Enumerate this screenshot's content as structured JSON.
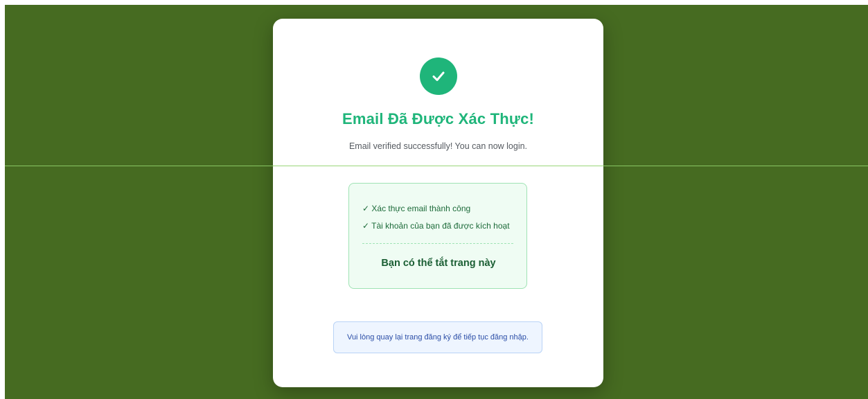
{
  "page": {
    "background_color": "#466b21",
    "accent_color": "#1fb57a"
  },
  "card": {
    "icon": "checkmark-icon",
    "title": "Email Đã Được Xác Thực!",
    "subtitle": "Email verified successfully! You can now login."
  },
  "success_box": {
    "items": [
      "✓ Xác thực email thành công",
      "✓ Tài khoản của bạn đã được kích hoạt"
    ],
    "closing_note": "Bạn có thể tắt trang này"
  },
  "info_box": {
    "text": "Vui lòng quay lại trang đăng ký để tiếp tục đăng nhập."
  }
}
